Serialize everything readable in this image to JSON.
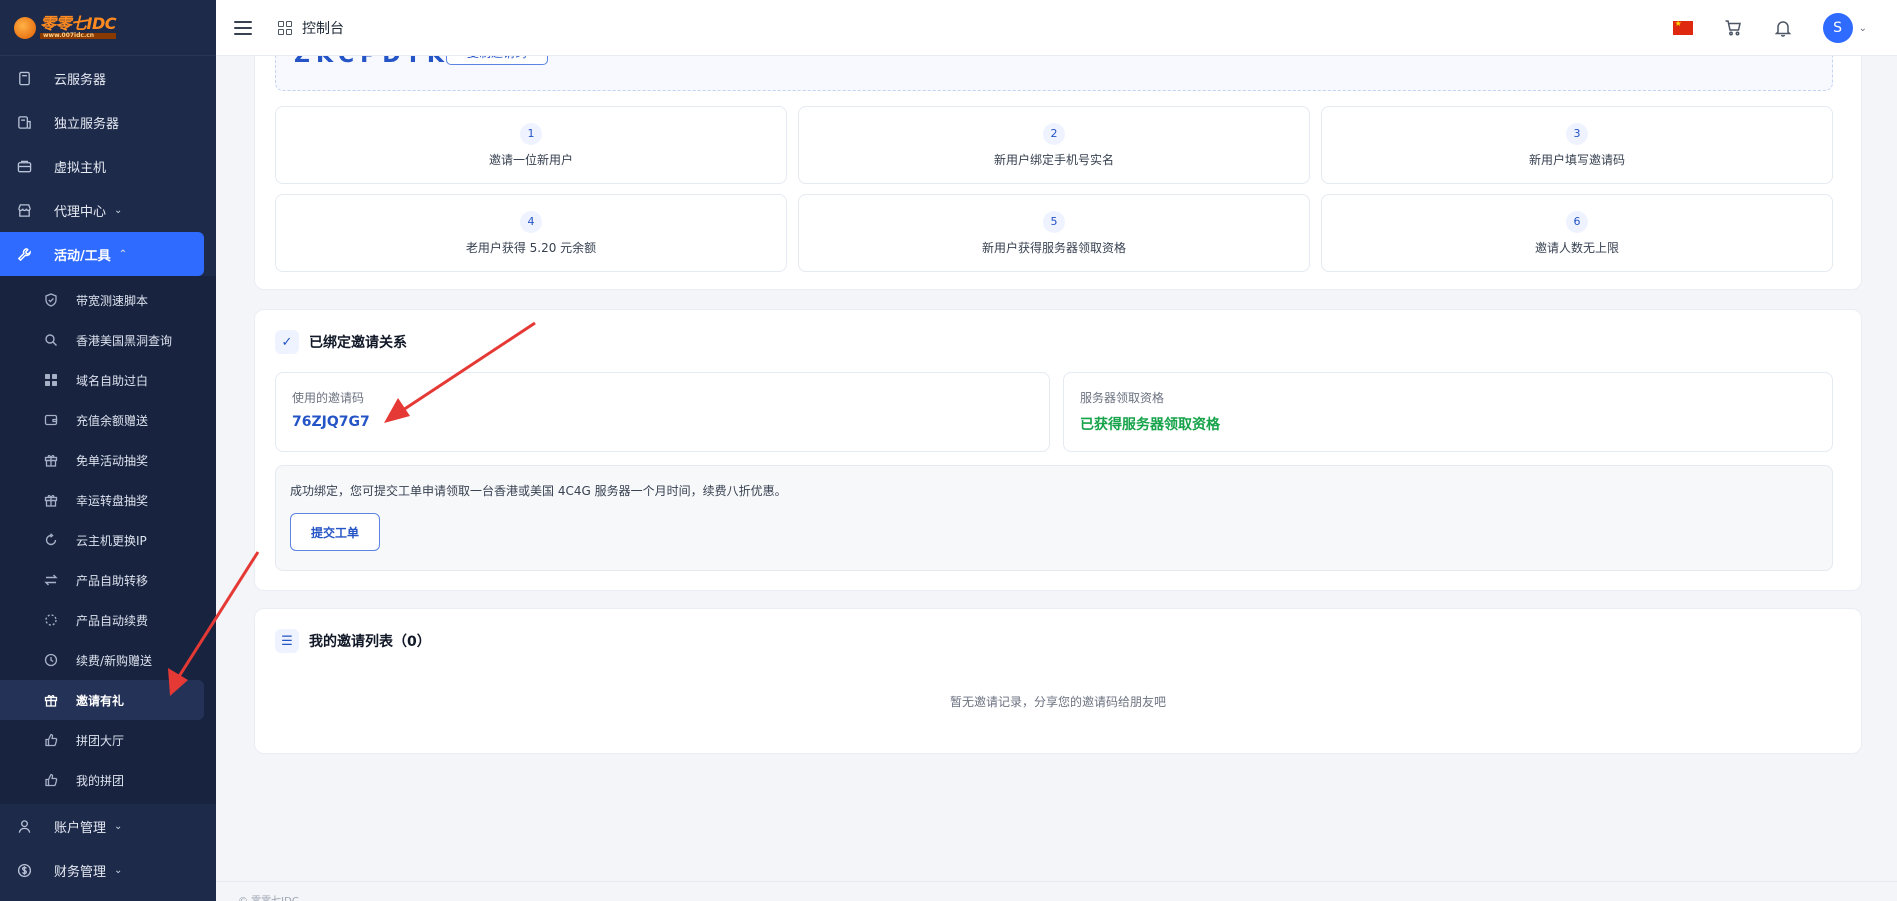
{
  "logo": {
    "text": "零零七IDC",
    "sub": "www.007idc.cn"
  },
  "sidebar": {
    "items": [
      {
        "label": "云服务器",
        "icon": "server-icon"
      },
      {
        "label": "独立服务器",
        "icon": "dedicated-server-icon"
      },
      {
        "label": "虚拟主机",
        "icon": "hosting-icon"
      },
      {
        "label": "代理中心",
        "icon": "store-icon",
        "chevron": "⌄"
      },
      {
        "label": "活动/工具",
        "icon": "wrench-icon",
        "chevron": "⌃"
      }
    ],
    "sub_items": [
      {
        "label": "带宽测速脚本",
        "icon": "shield-icon"
      },
      {
        "label": "香港美国黑洞查询",
        "icon": "search-icon"
      },
      {
        "label": "域名自助过白",
        "icon": "grid-icon"
      },
      {
        "label": "充值余额赠送",
        "icon": "wallet-icon"
      },
      {
        "label": "免单活动抽奖",
        "icon": "gift-icon"
      },
      {
        "label": "幸运转盘抽奖",
        "icon": "gift-icon"
      },
      {
        "label": "云主机更换IP",
        "icon": "refresh-icon"
      },
      {
        "label": "产品自助转移",
        "icon": "transfer-icon"
      },
      {
        "label": "产品自动续费",
        "icon": "loading-icon"
      },
      {
        "label": "续费/新购赠送",
        "icon": "clock-icon"
      },
      {
        "label": "邀请有礼",
        "icon": "gift-icon"
      },
      {
        "label": "拼团大厅",
        "icon": "thumbs-up-icon"
      },
      {
        "label": "我的拼团",
        "icon": "thumbs-up-icon"
      }
    ],
    "bottom_items": [
      {
        "label": "账户管理",
        "icon": "user-icon",
        "chevron": "⌄"
      },
      {
        "label": "财务管理",
        "icon": "money-icon",
        "chevron": "⌄"
      }
    ]
  },
  "header": {
    "breadcrumb": "控制台",
    "avatar_letter": "S",
    "avatar_chevron": "⌄"
  },
  "invite": {
    "code_display": "ZKCPDYKW",
    "copy_label": "复制邀请码",
    "steps": [
      {
        "num": "1",
        "text": "邀请一位新用户"
      },
      {
        "num": "2",
        "text": "新用户绑定手机号实名"
      },
      {
        "num": "3",
        "text": "新用户填写邀请码"
      },
      {
        "num": "4",
        "text": "老用户获得 5.20 元余额"
      },
      {
        "num": "5",
        "text": "新用户获得服务器领取资格"
      },
      {
        "num": "6",
        "text": "邀请人数无上限"
      }
    ]
  },
  "binding": {
    "icon_glyph": "✓",
    "title": "已绑定邀请关系",
    "used_code_label": "使用的邀请码",
    "used_code_value": "76ZJQ7G7",
    "qualification_label": "服务器领取资格",
    "qualification_value": "已获得服务器领取资格",
    "notice": "成功绑定，您可提交工单申请领取一台香港或美国 4C4G 服务器一个月时间，续费八折优惠。",
    "ticket_button": "提交工单"
  },
  "invite_list": {
    "icon_glyph": "☰",
    "title": "我的邀请列表（0）",
    "empty_text": "暂无邀请记录，分享您的邀请码给朋友吧"
  },
  "footer": {
    "text": "© 零零七IDC"
  },
  "colors": {
    "primary": "#2f6bff",
    "sidebar": "#1d2a4a",
    "success": "#16a34a",
    "annotation": "#e53935"
  }
}
